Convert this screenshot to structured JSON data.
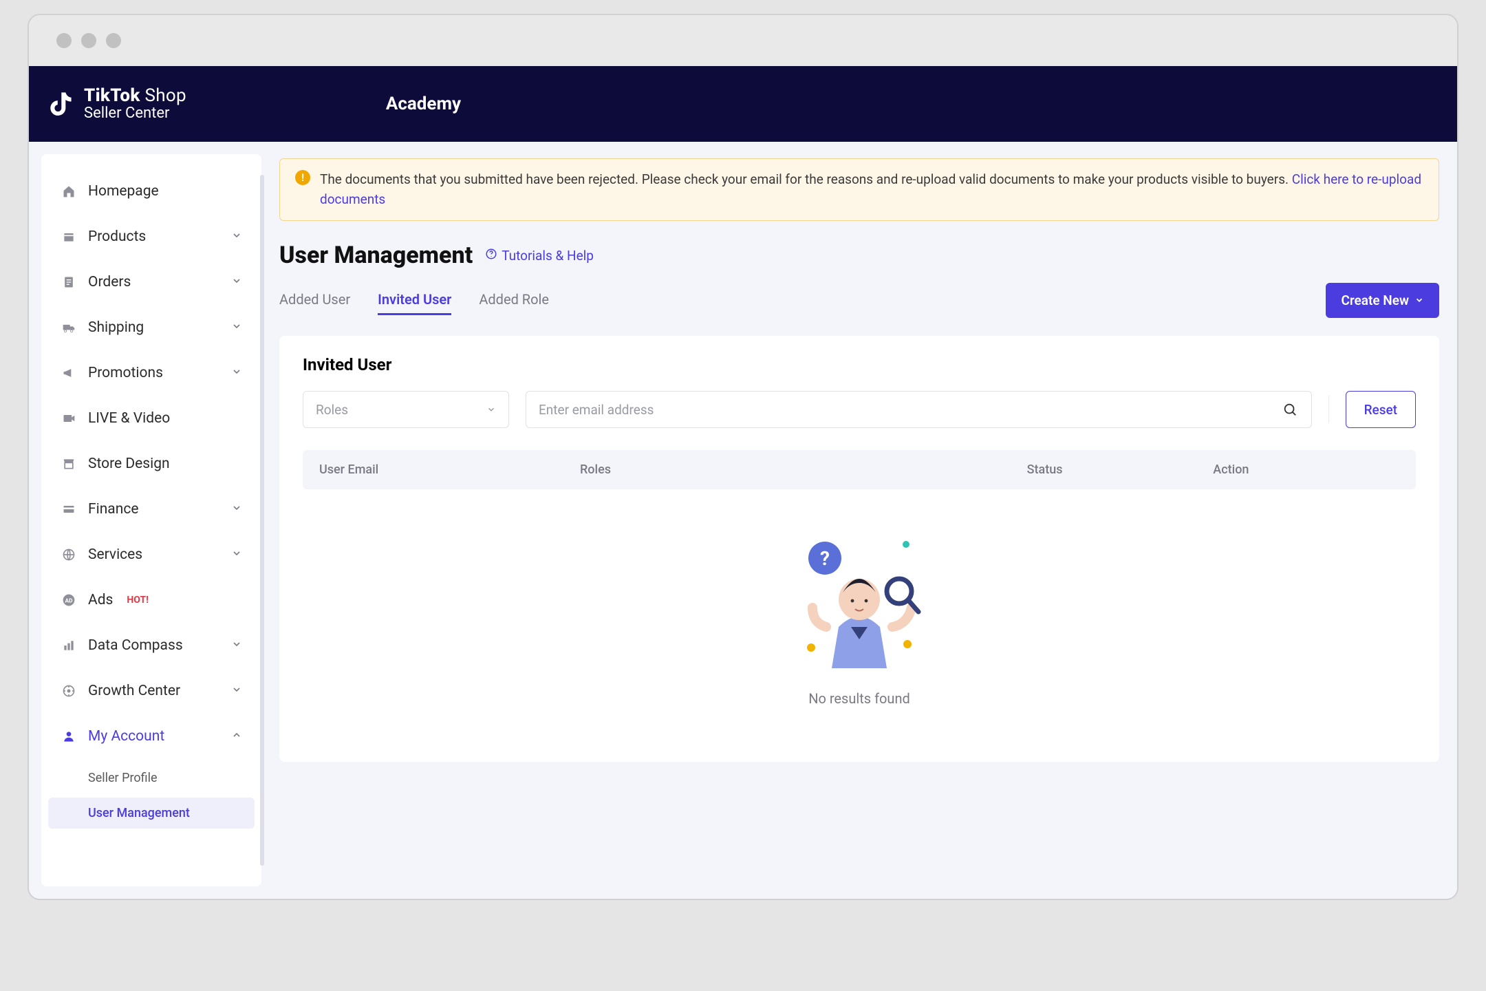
{
  "brand": {
    "line1_bold": "TikTok",
    "line1_thin": "Shop",
    "line2": "Seller Center"
  },
  "topnav": {
    "academy": "Academy"
  },
  "sidebar": {
    "items": [
      {
        "label": "Homepage",
        "icon": "home",
        "expandable": false
      },
      {
        "label": "Products",
        "icon": "box",
        "expandable": true
      },
      {
        "label": "Orders",
        "icon": "doc",
        "expandable": true
      },
      {
        "label": "Shipping",
        "icon": "truck",
        "expandable": true
      },
      {
        "label": "Promotions",
        "icon": "megaphone",
        "expandable": true
      },
      {
        "label": "LIVE & Video",
        "icon": "video",
        "expandable": false
      },
      {
        "label": "Store Design",
        "icon": "store",
        "expandable": false
      },
      {
        "label": "Finance",
        "icon": "card",
        "expandable": true
      },
      {
        "label": "Services",
        "icon": "globe",
        "expandable": true
      },
      {
        "label": "Ads",
        "icon": "ad",
        "expandable": false,
        "badge": "HOT!"
      },
      {
        "label": "Data Compass",
        "icon": "bar",
        "expandable": true
      },
      {
        "label": "Growth Center",
        "icon": "rocket",
        "expandable": true
      },
      {
        "label": "My Account",
        "icon": "user",
        "expandable": true,
        "active": true,
        "open": true
      }
    ],
    "subitems": [
      {
        "label": "Seller Profile",
        "current": false
      },
      {
        "label": "User Management",
        "current": true
      }
    ]
  },
  "alert": {
    "text": "The documents that you submitted have been rejected. Please check your email for the reasons and re-upload valid documents to make your products visible to buyers. ",
    "link": "Click here to re-upload documents"
  },
  "page": {
    "title": "User Management",
    "help": "Tutorials & Help"
  },
  "tabs": [
    {
      "label": "Added User",
      "active": false
    },
    {
      "label": "Invited User",
      "active": true
    },
    {
      "label": "Added Role",
      "active": false
    }
  ],
  "create_button": "Create New",
  "panel": {
    "title": "Invited User",
    "roles_placeholder": "Roles",
    "email_placeholder": "Enter email address",
    "reset": "Reset",
    "columns": [
      "User Email",
      "Roles",
      "Status",
      "Action"
    ],
    "empty": "No results found"
  }
}
